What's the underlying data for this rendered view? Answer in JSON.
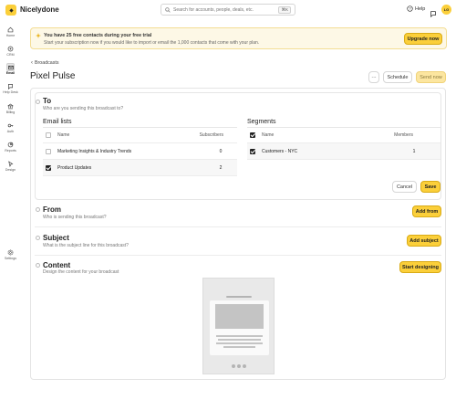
{
  "app": {
    "name": "Nicelydone"
  },
  "search": {
    "placeholder": "Search for accounts, people, deals, etc.",
    "shortcut": "⌘K"
  },
  "header": {
    "help_label": "Help",
    "avatar_initials": "LG"
  },
  "sidebar": {
    "items": [
      {
        "label": "Home",
        "icon": "home-icon"
      },
      {
        "label": "CRM",
        "icon": "crm-icon"
      },
      {
        "label": "Email",
        "icon": "email-icon",
        "active": true
      },
      {
        "label": "Help Desk",
        "icon": "help-desk-icon"
      },
      {
        "label": "Billing",
        "icon": "billing-icon"
      },
      {
        "label": "Auth",
        "icon": "auth-icon"
      },
      {
        "label": "Reports",
        "icon": "reports-icon"
      },
      {
        "label": "Design",
        "icon": "design-icon"
      },
      {
        "label": "Settings",
        "icon": "settings-icon"
      }
    ]
  },
  "banner": {
    "title": "You have 25 free contacts during your free trial",
    "text": "Start your subscription now if you would like to import or email the 1,000 contacts that come with your plan.",
    "button": "Upgrade now"
  },
  "breadcrumb": {
    "label": "Broadcasts"
  },
  "page": {
    "title": "Pixel Pulse",
    "more_label": "···",
    "schedule_label": "Schedule",
    "send_label": "Send now"
  },
  "to": {
    "title": "To",
    "subtitle": "Who are you sending this broadcast to?",
    "email_lists": {
      "title": "Email lists",
      "col_name": "Name",
      "col_count": "Subscribers",
      "rows": [
        {
          "name": "Marketing Insights & Industry Trends",
          "count": "0",
          "checked": false
        },
        {
          "name": "Product Updates",
          "count": "2",
          "checked": true
        }
      ]
    },
    "segments": {
      "title": "Segments",
      "col_name": "Name",
      "col_count": "Members",
      "rows": [
        {
          "name": "Customers - NYC",
          "count": "1",
          "checked": true
        }
      ]
    },
    "cancel_label": "Cancel",
    "save_label": "Save"
  },
  "from": {
    "title": "From",
    "subtitle": "Who is sending this broadcast?",
    "button": "Add from"
  },
  "subject": {
    "title": "Subject",
    "subtitle": "What is the subject line for this broadcast?",
    "button": "Add subject"
  },
  "content": {
    "title": "Content",
    "subtitle": "Design the content for your broadcast",
    "button": "Start designing"
  },
  "colors": {
    "accent": "#fbcf3a",
    "banner_bg": "#fdf8e6",
    "banner_border": "#f3dd94"
  }
}
